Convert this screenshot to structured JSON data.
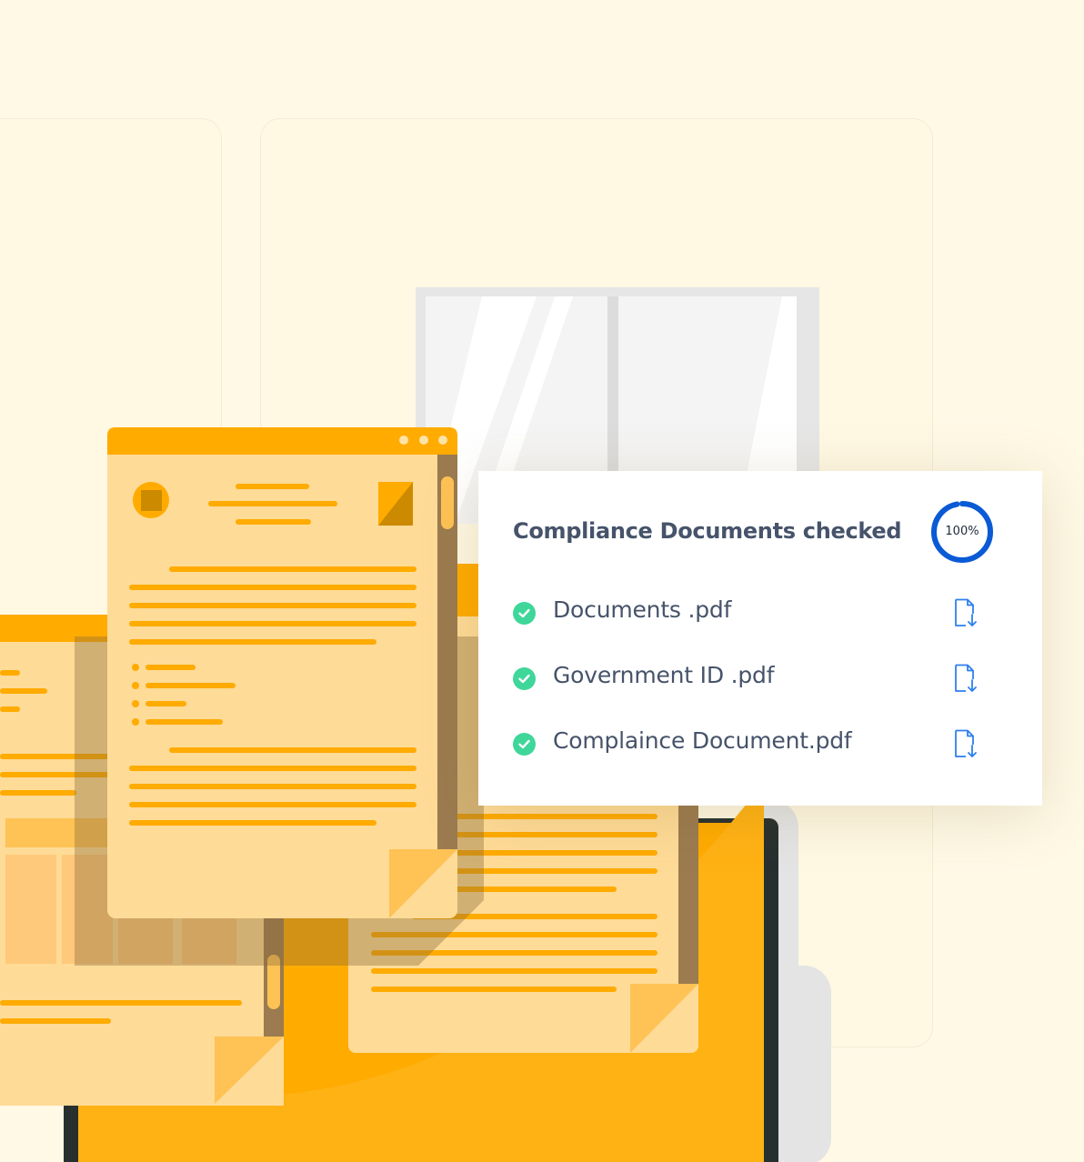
{
  "card": {
    "title": "Compliance Documents checked",
    "progress_label": "100%",
    "progress_value": 1.0
  },
  "documents": [
    {
      "name": "Documents .pdf",
      "status_icon": "check-circle-icon",
      "action_icon": "file-download-icon"
    },
    {
      "name": "Government ID .pdf",
      "status_icon": "check-circle-icon",
      "action_icon": "file-download-icon"
    },
    {
      "name": "Complaince Document.pdf",
      "status_icon": "check-circle-icon",
      "action_icon": "file-download-icon"
    }
  ],
  "colors": {
    "background": "#fff9e6",
    "accent_orange": "#ffab00",
    "paper": "#fedb97",
    "progress_ring": "#0a5ad6",
    "check_green": "#3fd69a",
    "download_blue": "#2d7ff0",
    "text": "#46536a"
  }
}
